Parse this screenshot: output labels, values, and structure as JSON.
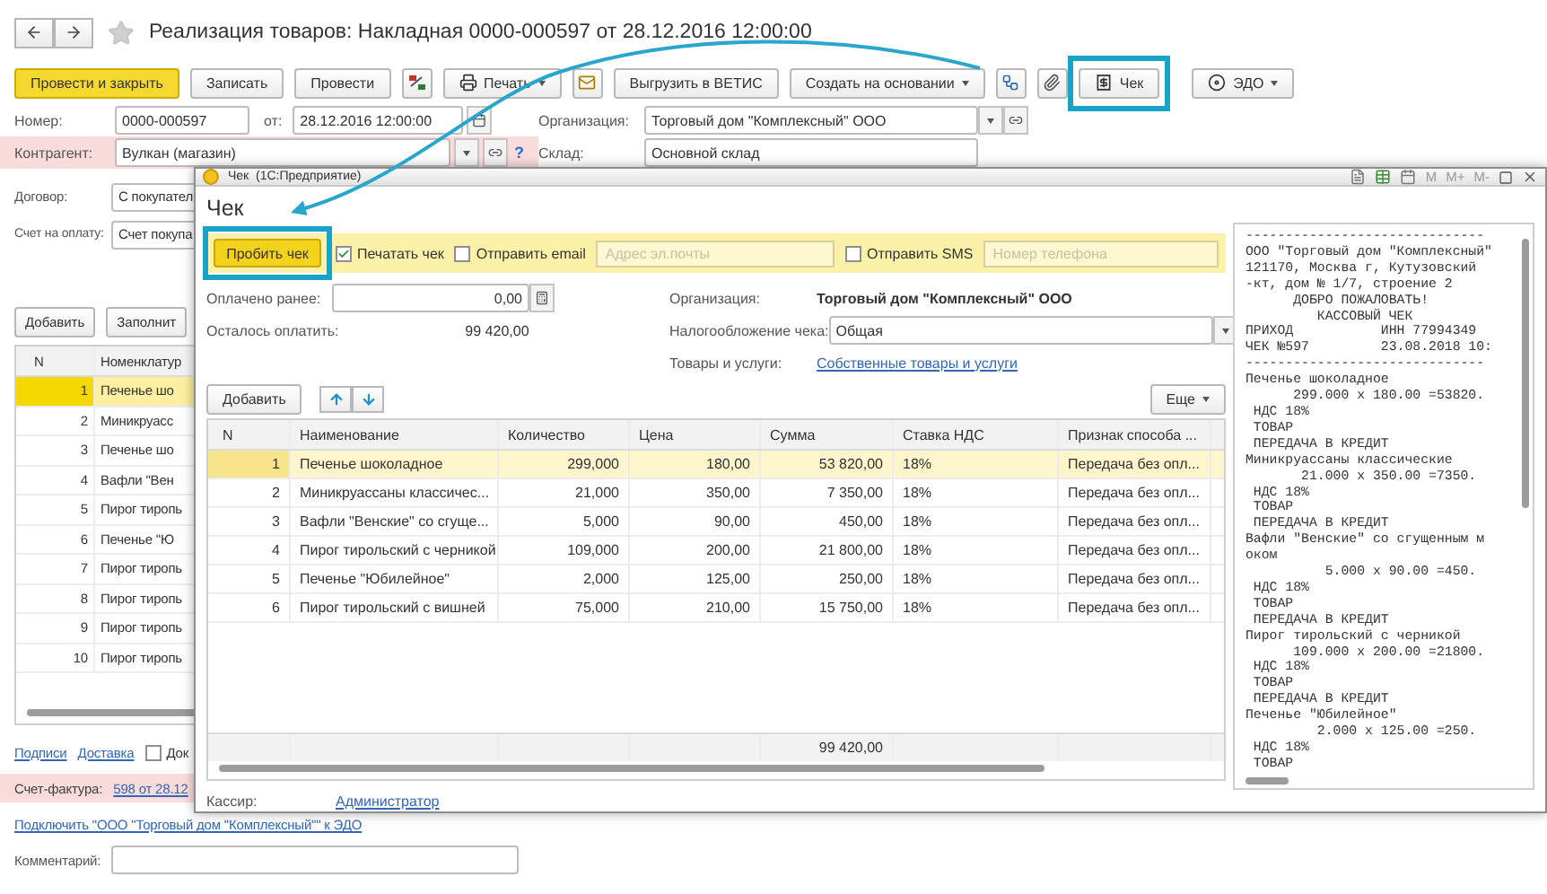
{
  "document": {
    "title": "Реализация товаров: Накладная 0000-000597 от 28.12.2016 12:00:00",
    "favorite": false
  },
  "toolbar": [
    {
      "label": "Провести и закрыть",
      "kind": "primary",
      "highlighted": false
    },
    {
      "label": "Записать",
      "kind": "plain",
      "highlighted": false
    },
    {
      "label": "Провести",
      "kind": "plain",
      "highlighted": false
    },
    {
      "label": "Печать",
      "kind": "menu",
      "highlighted": false
    },
    {
      "label": "Выгрузить в ВЕТИС",
      "kind": "plain",
      "highlighted": false
    },
    {
      "label": "Создать на основании",
      "kind": "menu",
      "highlighted": false
    },
    {
      "label": "Чек",
      "kind": "plain",
      "highlighted": true
    },
    {
      "label": "ЭДО",
      "kind": "menu",
      "highlighted": false
    }
  ],
  "number": {
    "label": "Номер:",
    "value": "0000-000597"
  },
  "date": {
    "label": "от:",
    "value": "28.12.2016 12:00:00"
  },
  "organization": {
    "label": "Организация:",
    "value": "Торговый дом \"Комплексный\" ООО"
  },
  "counterparty": {
    "label": "Контрагент:",
    "value": "Вулкан (магазин)",
    "help": "?"
  },
  "warehouse": {
    "label": "Склад:",
    "value": "Основной склад"
  },
  "contract": {
    "label": "Договор:",
    "value": "С покупател"
  },
  "payment_invoice": {
    "label": "Счет на оплату:",
    "value": "Счет покупа"
  },
  "goods_toolbar": [
    "Добавить",
    "Заполнит"
  ],
  "goods_table": {
    "columns": [
      "N",
      "Номенклатур"
    ],
    "rows": [
      {
        "n": "1",
        "name": "Печенье шо",
        "selected": true
      },
      {
        "n": "2",
        "name": "Миникруасс",
        "selected": false
      },
      {
        "n": "3",
        "name": "Печенье шо",
        "selected": false
      },
      {
        "n": "4",
        "name": "Вафли \"Вен",
        "selected": false
      },
      {
        "n": "5",
        "name": "Пирог тиропь",
        "selected": false
      },
      {
        "n": "6",
        "name": "Печенье \"Ю",
        "selected": false
      },
      {
        "n": "7",
        "name": "Пирог тиропь",
        "selected": false
      },
      {
        "n": "8",
        "name": "Пирог тиропь",
        "selected": false
      },
      {
        "n": "9",
        "name": "Пирог тиропь",
        "selected": false
      },
      {
        "n": "10",
        "name": "Пирог тиропь",
        "selected": false
      }
    ]
  },
  "bottom_links": [
    "Подписи",
    "Доставка"
  ],
  "delivery_checkbox": {
    "label": "Док",
    "checked": false
  },
  "invoice": {
    "label": "Счет-фактура:",
    "link": "598 от 28.12"
  },
  "edo_link": "Подключить \"ООО \"Торговый дом \"Комплексный\"\" к ЭДО",
  "comment": {
    "label": "Комментарий:"
  },
  "dialog": {
    "title": "Чек  (1С:Предприятие)",
    "memory_buttons": [
      "M",
      "M+",
      "M-"
    ],
    "heading": "Чек",
    "submit": {
      "label": "Пробить чек",
      "highlighted": true
    },
    "options": [
      {
        "kind": "checkbox",
        "label": "Печатать чек",
        "checked": true
      },
      {
        "kind": "checkbox",
        "label": "Отправить email",
        "checked": false
      },
      {
        "kind": "field",
        "placeholder": "Адрес эл.почты"
      },
      {
        "kind": "checkbox",
        "label": "Отправить SMS",
        "checked": false
      },
      {
        "kind": "field",
        "placeholder": "Номер телефона"
      }
    ],
    "paid_before": {
      "label": "Оплачено ранее:",
      "value": "0,00"
    },
    "remaining": {
      "label": "Осталось оплатить:",
      "value": "99 420,00"
    },
    "organization": {
      "label": "Организация:",
      "value": "Торговый дом \"Комплексный\" ООО"
    },
    "taxation": {
      "label": "Налогообложение чека:",
      "value": "Общая"
    },
    "goods": {
      "label": "Товары и услуги:",
      "link": "Собственные товары и услуги"
    },
    "table_toolbar": {
      "add": "Добавить",
      "more": "Еще"
    },
    "table": {
      "columns": [
        "N",
        "Наименование",
        "Количество",
        "Цена",
        "Сумма",
        "Ставка НДС",
        "Признак способа ..."
      ],
      "rows": [
        {
          "cells": [
            "1",
            "Печенье шоколадное",
            "299,000",
            "180,00",
            "53 820,00",
            "18%",
            "Передача без опл..."
          ],
          "selected": true
        },
        {
          "cells": [
            "2",
            "Миникруассаны классичес...",
            "21,000",
            "350,00",
            "7 350,00",
            "18%",
            "Передача без опл..."
          ],
          "selected": false
        },
        {
          "cells": [
            "3",
            "Вафли \"Венские\" со сгуще...",
            "5,000",
            "90,00",
            "450,00",
            "18%",
            "Передача без опл..."
          ],
          "selected": false
        },
        {
          "cells": [
            "4",
            "Пирог тирольский с черникой",
            "109,000",
            "200,00",
            "21 800,00",
            "18%",
            "Передача без опл..."
          ],
          "selected": false
        },
        {
          "cells": [
            "5",
            "Печенье \"Юбилейное\"",
            "2,000",
            "125,00",
            "250,00",
            "18%",
            "Передача без опл..."
          ],
          "selected": false
        },
        {
          "cells": [
            "6",
            "Пирог тирольский с вишней",
            "75,000",
            "210,00",
            "15 750,00",
            "18%",
            "Передача без опл..."
          ],
          "selected": false
        }
      ],
      "total": "99 420,00"
    },
    "cashier": {
      "label": "Кассир:",
      "link": "Администратор"
    },
    "receipt": [
      "------------------------------",
      "ООО \"Торговый дом \"Комплексный\"",
      "121170, Москва г, Кутузовский",
      "-кт, дом № 1/7, строение 2",
      "      ДОБРО ПОЖАЛОВАТЬ!",
      "         КАССОВЫЙ ЧЕК",
      "ПРИХОД           ИНН 77994349",
      "ЧЕК №597         23.08.2018 10:",
      "------------------------------",
      "Печенье шоколадное",
      "      299.000 x 180.00 =53820.",
      " НДС 18%",
      " ТОВАР",
      " ПЕРЕДАЧА В КРЕДИТ",
      "Миникруассаны классические",
      "       21.000 x 350.00 =7350.",
      " НДС 18%",
      " ТОВАР",
      " ПЕРЕДАЧА В КРЕДИТ",
      "Вафли \"Венские\" со сгущенным м",
      "оком",
      "          5.000 x 90.00 =450.",
      " НДС 18%",
      " ТОВАР",
      " ПЕРЕДАЧА В КРЕДИТ",
      "Пирог тирольский с черникой",
      "      109.000 x 200.00 =21800.",
      " НДС 18%",
      " ТОВАР",
      " ПЕРЕДАЧА В КРЕДИТ",
      "Печенье \"Юбилейное\"",
      "         2.000 x 125.00 =250.",
      " НДС 18%",
      " ТОВАР"
    ]
  }
}
